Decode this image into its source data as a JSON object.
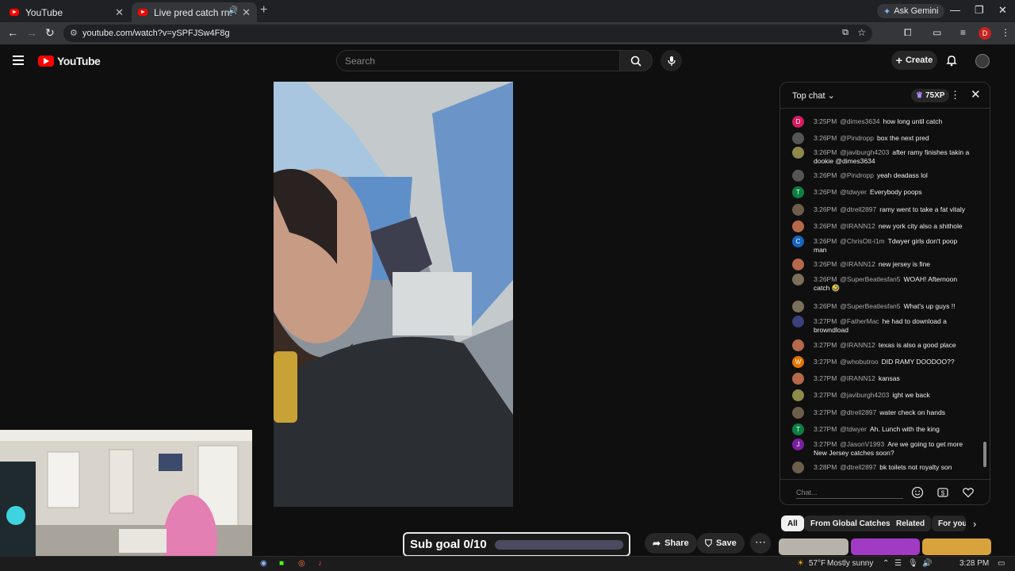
{
  "browser": {
    "tabs": [
      {
        "title": "YouTube"
      },
      {
        "title": "Live pred catch rn! - YouTub"
      }
    ],
    "url": "youtube.com/watch?v=ySPFJSw4F8g",
    "gemini_label": "Ask Gemini",
    "profile_initial": "D"
  },
  "header": {
    "logo_text": "YouTube",
    "search_placeholder": "Search",
    "create_label": "Create"
  },
  "video": {
    "sub_goal_label": "Sub goal 0/10",
    "sub_goal_progress": 0,
    "share_label": "Share",
    "save_label": "Save"
  },
  "chat": {
    "title": "Top chat",
    "xp_label": "75XP",
    "input_placeholder": "Chat...",
    "messages": [
      {
        "time": "3:25PM",
        "user": "@dimes3634",
        "text": "how long until catch",
        "avatar_letter": "D",
        "avatar_color": "#d81b60"
      },
      {
        "time": "3:26PM",
        "user": "@Pindropp",
        "text": "box the next pred",
        "avatar_letter": "",
        "avatar_color": "#555555"
      },
      {
        "time": "3:26PM",
        "user": "@javiburgh4203",
        "text": "after ramy finishes takin a dookie @dimes3634",
        "avatar_letter": "",
        "avatar_color": "#8d8a4a"
      },
      {
        "time": "3:26PM",
        "user": "@Pindropp",
        "text": "yeah deadass lol",
        "avatar_letter": "",
        "avatar_color": "#555555"
      },
      {
        "time": "3:26PM",
        "user": "@tdwyer",
        "text": "Everybody poops",
        "avatar_letter": "T",
        "avatar_color": "#0b8043"
      },
      {
        "time": "3:26PM",
        "user": "@dtrell2897",
        "text": "ramy went to take a fat vitaly",
        "avatar_letter": "",
        "avatar_color": "#6d5d4b"
      },
      {
        "time": "3:26PM",
        "user": "@IRANN12",
        "text": "new york city also a shithole",
        "avatar_letter": "",
        "avatar_color": "#b5684a"
      },
      {
        "time": "3:26PM",
        "user": "@ChrisOtt-l1m",
        "text": "Tdwyer girls don't poop man",
        "avatar_letter": "C",
        "avatar_color": "#1565c0"
      },
      {
        "time": "3:26PM",
        "user": "@IRANN12",
        "text": "new jersey is fine",
        "avatar_letter": "",
        "avatar_color": "#b5684a"
      },
      {
        "time": "3:26PM",
        "user": "@SuperBeatlesfan5",
        "text": "WOAH! Afternoon catch 🤣",
        "avatar_letter": "",
        "avatar_color": "#7a6f5a"
      },
      {
        "time": "3:26PM",
        "user": "@SuperBeatlesfan5",
        "text": "What's up guys !!",
        "avatar_letter": "",
        "avatar_color": "#7a6f5a"
      },
      {
        "time": "3:27PM",
        "user": "@FatherMac",
        "text": "he had to download a browndload",
        "avatar_letter": "",
        "avatar_color": "#3b3f7a"
      },
      {
        "time": "3:27PM",
        "user": "@IRANN12",
        "text": "texas is also a good place",
        "avatar_letter": "",
        "avatar_color": "#b5684a"
      },
      {
        "time": "3:27PM",
        "user": "@whobutroo",
        "text": "DID RAMY DOODOO??",
        "avatar_letter": "W",
        "avatar_color": "#e37400"
      },
      {
        "time": "3:27PM",
        "user": "@IRANN12",
        "text": "kansas",
        "avatar_letter": "",
        "avatar_color": "#b5684a"
      },
      {
        "time": "3:27PM",
        "user": "@javiburgh4203",
        "text": "ight we back",
        "avatar_letter": "",
        "avatar_color": "#8d8a4a"
      },
      {
        "time": "3:27PM",
        "user": "@dtrell2897",
        "text": "water check on hands",
        "avatar_letter": "",
        "avatar_color": "#6d5d4b"
      },
      {
        "time": "3:27PM",
        "user": "@tdwyer",
        "text": "Ah. Lunch with the king",
        "avatar_letter": "T",
        "avatar_color": "#0b8043"
      },
      {
        "time": "3:27PM",
        "user": "@JasonV1993",
        "text": "Are we going to get more New Jersey catches soon?",
        "avatar_letter": "J",
        "avatar_color": "#7b1fa2"
      },
      {
        "time": "3:28PM",
        "user": "@dtrell2897",
        "text": "bk toilets not royalty son",
        "avatar_letter": "",
        "avatar_color": "#6d5d4b"
      }
    ]
  },
  "chips": {
    "all": "All",
    "from_channel": "From Global Catches",
    "related": "Related",
    "for_you": "For you"
  },
  "taskbar": {
    "temperature": "57°F",
    "weather": "Mostly sunny",
    "time": "3:28 PM"
  }
}
